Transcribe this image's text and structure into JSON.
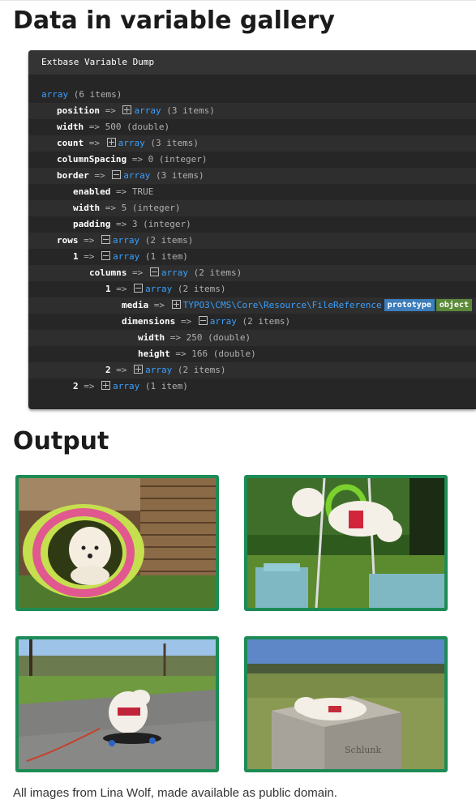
{
  "page": {
    "title": "Data in variable gallery",
    "output_title": "Output",
    "footnote": "All images from Lina Wolf, made available as public domain."
  },
  "dump": {
    "header": "Extbase Variable Dump",
    "lines": [
      {
        "key": "",
        "type": "array",
        "meta": "(6 items)"
      },
      {
        "key": "position",
        "toggle": "plus",
        "type": "array",
        "meta": "(3 items)"
      },
      {
        "key": "width",
        "value": "500 (double)"
      },
      {
        "key": "count",
        "toggle": "plus",
        "type": "array",
        "meta": "(3 items)"
      },
      {
        "key": "columnSpacing",
        "value": "0 (integer)"
      },
      {
        "key": "border",
        "toggle": "minus",
        "type": "array",
        "meta": "(3 items)"
      },
      {
        "key": "enabled",
        "value": "TRUE"
      },
      {
        "key": "width",
        "value": "5 (integer)"
      },
      {
        "key": "padding",
        "value": "3 (integer)"
      },
      {
        "key": "rows",
        "toggle": "minus",
        "type": "array",
        "meta": "(2 items)"
      },
      {
        "key": "1",
        "toggle": "minus",
        "type": "array",
        "meta": "(1 item)"
      },
      {
        "key": "columns",
        "toggle": "minus",
        "type": "array",
        "meta": "(2 items)"
      },
      {
        "key": "1",
        "toggle": "minus",
        "type": "array",
        "meta": "(2 items)"
      },
      {
        "key": "media",
        "toggle": "plus",
        "class": "TYPO3\\CMS\\Core\\Resource\\FileReference",
        "badge1": "prototype",
        "badge2": "object"
      },
      {
        "key": "dimensions",
        "toggle": "minus",
        "type": "array",
        "meta": "(2 items)"
      },
      {
        "key": "width",
        "value": "250 (double)"
      },
      {
        "key": "height",
        "value": "166 (double)"
      },
      {
        "key": "2",
        "toggle": "plus",
        "type": "array",
        "meta": "(2 items)"
      },
      {
        "key": "2",
        "toggle": "plus",
        "type": "array",
        "meta": "(1 item)"
      }
    ]
  },
  "gallery": {
    "border_color": "#1d8b55",
    "images": [
      {
        "name": "dog-in-tunnel"
      },
      {
        "name": "dog-jumping-through-ring"
      },
      {
        "name": "dog-on-skateboard"
      },
      {
        "name": "dog-on-stone-block",
        "engraving": "Schlunk"
      }
    ]
  }
}
